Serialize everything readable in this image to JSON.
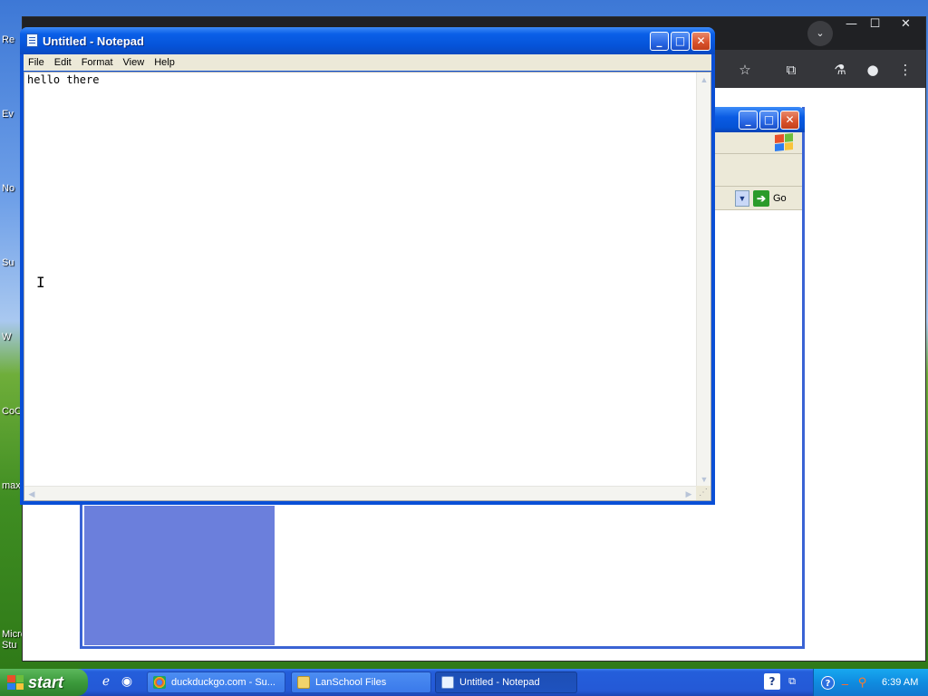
{
  "notepad": {
    "title": "Untitled - Notepad",
    "menu": [
      "File",
      "Edit",
      "Format",
      "View",
      "Help"
    ],
    "content": "hello there",
    "buttons": {
      "minimize": "_",
      "maximize": "□",
      "close": "✕"
    }
  },
  "explorer": {
    "go_label": "Go"
  },
  "chrome": {
    "controls": {
      "minimize": "—",
      "maximize": "☐",
      "close": "✕"
    }
  },
  "desktop_icons": [
    "Re",
    "Ev",
    "No",
    "Su",
    "W",
    "CoC",
    "max",
    "Micro",
    "Stu"
  ],
  "taskbar": {
    "start_label": "start",
    "tasks": [
      {
        "label": "duckduckgo.com - Su...",
        "icon": "chrome-icon",
        "active": false
      },
      {
        "label": "LanSchool Files",
        "icon": "folder-icon",
        "active": false
      },
      {
        "label": "Untitled - Notepad",
        "icon": "notepad-icon",
        "active": true
      }
    ],
    "clock": "6:39 AM"
  },
  "colors": {
    "xp_blue": "#0553d8",
    "start_green": "#3c9a3c",
    "tray_blue": "#0f8ce0",
    "chrome_dark": "#35363a"
  }
}
